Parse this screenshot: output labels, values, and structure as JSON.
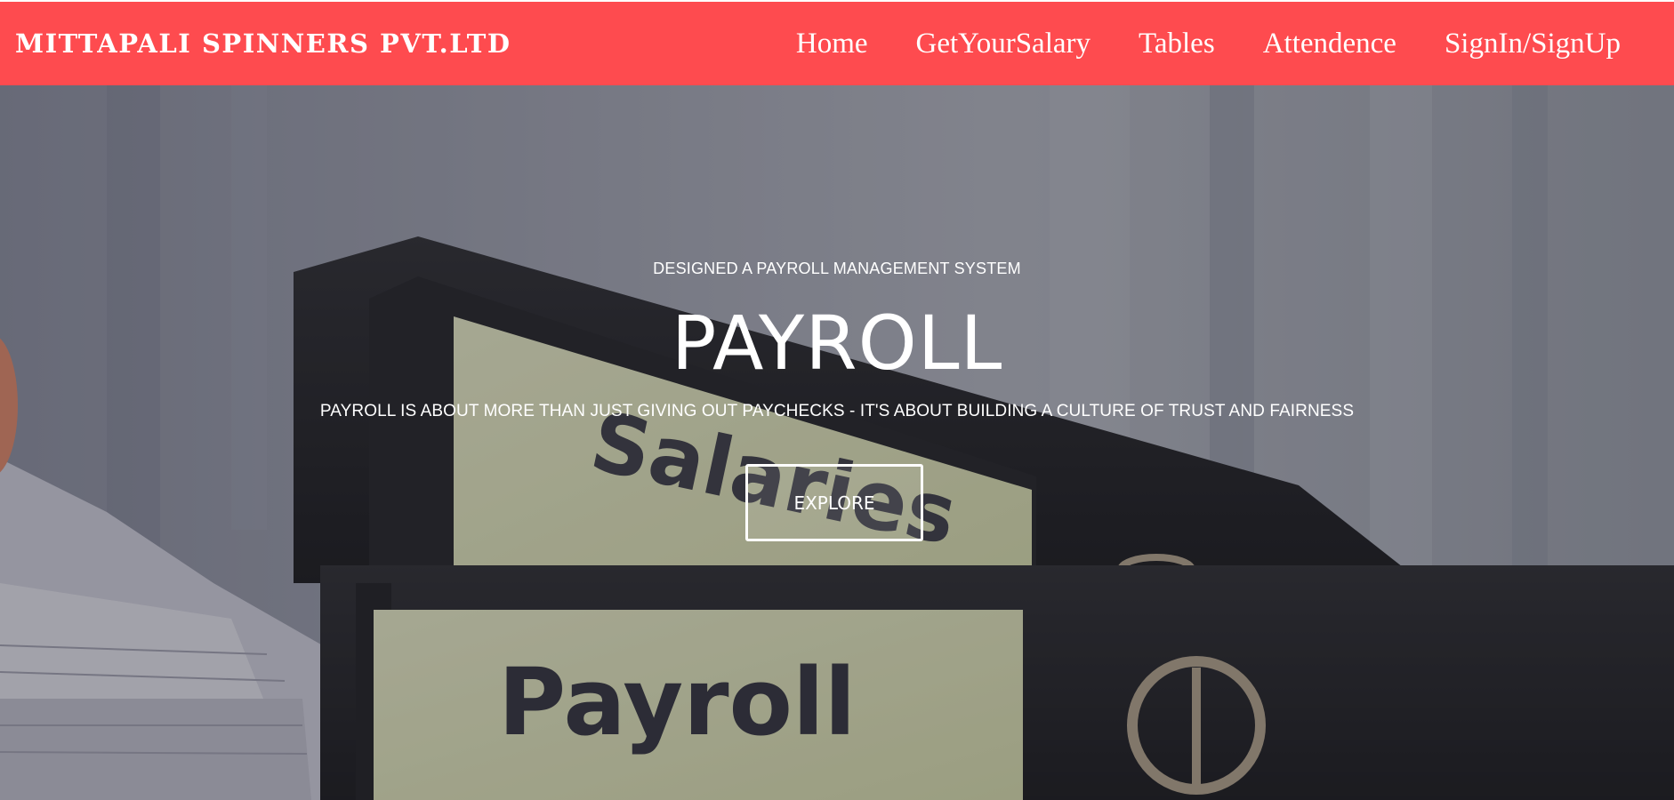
{
  "header": {
    "brand": "MITTAPALI SPINNERS PVT.LTD",
    "nav": [
      {
        "label": "Home"
      },
      {
        "label": "GetYourSalary"
      },
      {
        "label": "Tables"
      },
      {
        "label": "Attendence"
      },
      {
        "label": "SignIn/SignUp"
      }
    ],
    "background_color": "#fe4b4f"
  },
  "hero": {
    "kicker": "DESIGNED A PAYROLL MANAGEMENT SYSTEM",
    "title": "PAYROLL",
    "subtitle": "PAYROLL IS ABOUT MORE THAN JUST GIVING OUT PAYCHECKS - IT'S ABOUT BUILDING A CULTURE OF TRUST AND FAIRNESS",
    "button_label": "EXPLORE",
    "background_image": {
      "description_labels": [
        "Salaries",
        "Payroll"
      ]
    }
  }
}
